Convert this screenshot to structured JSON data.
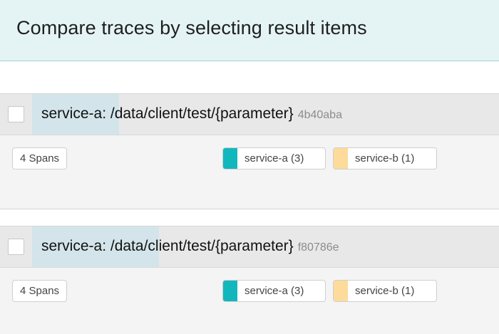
{
  "banner": {
    "title": "Compare traces by selecting result items"
  },
  "results": [
    {
      "title": "service-a: /data/client/test/{parameter}",
      "trace_id": "4b40aba",
      "spans_label": "4 Spans",
      "services": [
        {
          "label": "service-a (3)",
          "color": "#12b7bd"
        },
        {
          "label": "service-b (1)",
          "color": "#fddb9a"
        }
      ]
    },
    {
      "title": "service-a: /data/client/test/{parameter}",
      "trace_id": "f80786e",
      "spans_label": "4 Spans",
      "services": [
        {
          "label": "service-a (3)",
          "color": "#12b7bd"
        },
        {
          "label": "service-b (1)",
          "color": "#fddb9a"
        }
      ]
    }
  ]
}
